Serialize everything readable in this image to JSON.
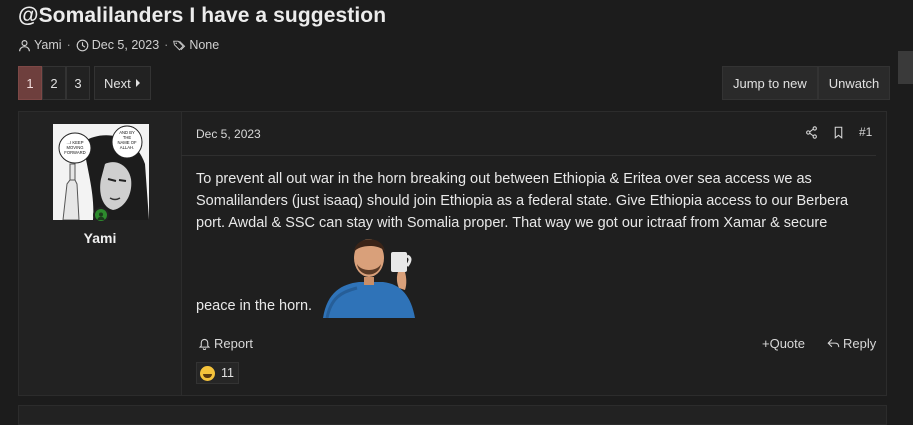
{
  "thread": {
    "title": "@Somalilanders I have a suggestion",
    "author": "Yami",
    "date": "Dec 5, 2023",
    "tags": "None"
  },
  "pagination": {
    "pages": [
      "1",
      "2",
      "3"
    ],
    "current": "1",
    "next_label": "Next"
  },
  "thread_actions": {
    "jump_label": "Jump to new",
    "unwatch_label": "Unwatch"
  },
  "post": {
    "username": "Yami",
    "date": "Dec 5, 2023",
    "number": "#1",
    "body": "To prevent all out war in the horn breaking out between Ethiopia & Eritea over sea access we as Somalilanders (just isaaq) should join Ethiopia as a federal state. Give Ethiopia access to our Berbera port. Awdal & SSC can stay with Somalia proper. That way we got our ictraaf from Xamar & secure",
    "body_end": "peace in the horn.",
    "report_label": "Report",
    "quote_label": "+Quote",
    "reply_label": "Reply",
    "reaction_count": "11",
    "avatar_text": [
      "...I KEEP MOVING FORWARD",
      "AND BY THE NAME OF ALLAH"
    ]
  },
  "colors": {
    "active_page": "#6e3f3d",
    "online": "#2d8a2d",
    "background": "#1c1c1c"
  }
}
